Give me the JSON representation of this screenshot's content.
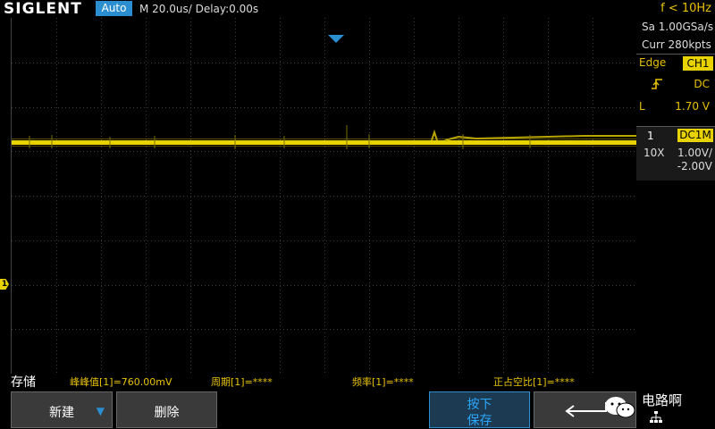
{
  "header": {
    "brand": "SIGLENT",
    "mode": "Auto",
    "timebase": "M 20.0us/  Delay:0.00s",
    "frequency": "f < 10Hz"
  },
  "side_panel": {
    "sample_rate": "Sa 1.00GSa/s",
    "memory_depth": "Curr 280kpts",
    "trigger_type": "Edge",
    "trigger_source": "CH1",
    "trigger_coupling": "DC",
    "trigger_level_label": "L",
    "trigger_level": "1.70 V",
    "channel_number": "1",
    "channel_coupling": "DC1M",
    "probe": "10X",
    "volts_per_div": "1.00V/",
    "offset": "-2.00V"
  },
  "screen": {
    "channel_marker": "1",
    "trace_color": "#e8d300",
    "grid_color": "#3c3c3c"
  },
  "measurements": {
    "title": "存储",
    "items": [
      {
        "label": "峰峰值[1]=760.00mV"
      },
      {
        "label": "周期[1]=****"
      },
      {
        "label": "频率[1]=****"
      },
      {
        "label": "正占空比[1]=****"
      }
    ]
  },
  "softkeys": {
    "new_label": "新建",
    "delete_label": "删除",
    "save_line1": "按下",
    "save_line2": "保存",
    "brand_overlay": "电路啊"
  }
}
